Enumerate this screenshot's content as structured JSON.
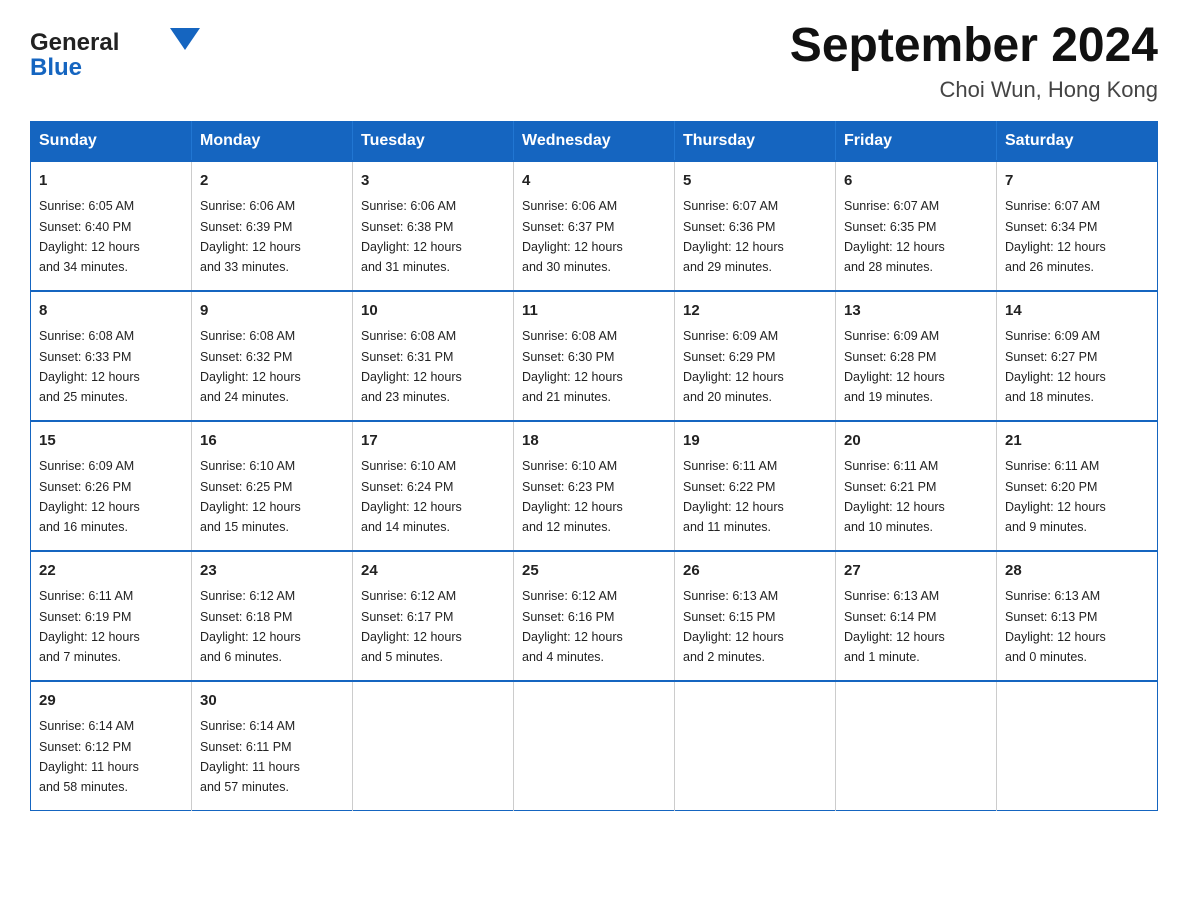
{
  "logo": {
    "text_general": "General",
    "text_blue": "Blue"
  },
  "title": "September 2024",
  "location": "Choi Wun, Hong Kong",
  "days_of_week": [
    "Sunday",
    "Monday",
    "Tuesday",
    "Wednesday",
    "Thursday",
    "Friday",
    "Saturday"
  ],
  "weeks": [
    [
      {
        "day": "1",
        "sunrise": "6:05 AM",
        "sunset": "6:40 PM",
        "daylight": "12 hours and 34 minutes."
      },
      {
        "day": "2",
        "sunrise": "6:06 AM",
        "sunset": "6:39 PM",
        "daylight": "12 hours and 33 minutes."
      },
      {
        "day": "3",
        "sunrise": "6:06 AM",
        "sunset": "6:38 PM",
        "daylight": "12 hours and 31 minutes."
      },
      {
        "day": "4",
        "sunrise": "6:06 AM",
        "sunset": "6:37 PM",
        "daylight": "12 hours and 30 minutes."
      },
      {
        "day": "5",
        "sunrise": "6:07 AM",
        "sunset": "6:36 PM",
        "daylight": "12 hours and 29 minutes."
      },
      {
        "day": "6",
        "sunrise": "6:07 AM",
        "sunset": "6:35 PM",
        "daylight": "12 hours and 28 minutes."
      },
      {
        "day": "7",
        "sunrise": "6:07 AM",
        "sunset": "6:34 PM",
        "daylight": "12 hours and 26 minutes."
      }
    ],
    [
      {
        "day": "8",
        "sunrise": "6:08 AM",
        "sunset": "6:33 PM",
        "daylight": "12 hours and 25 minutes."
      },
      {
        "day": "9",
        "sunrise": "6:08 AM",
        "sunset": "6:32 PM",
        "daylight": "12 hours and 24 minutes."
      },
      {
        "day": "10",
        "sunrise": "6:08 AM",
        "sunset": "6:31 PM",
        "daylight": "12 hours and 23 minutes."
      },
      {
        "day": "11",
        "sunrise": "6:08 AM",
        "sunset": "6:30 PM",
        "daylight": "12 hours and 21 minutes."
      },
      {
        "day": "12",
        "sunrise": "6:09 AM",
        "sunset": "6:29 PM",
        "daylight": "12 hours and 20 minutes."
      },
      {
        "day": "13",
        "sunrise": "6:09 AM",
        "sunset": "6:28 PM",
        "daylight": "12 hours and 19 minutes."
      },
      {
        "day": "14",
        "sunrise": "6:09 AM",
        "sunset": "6:27 PM",
        "daylight": "12 hours and 18 minutes."
      }
    ],
    [
      {
        "day": "15",
        "sunrise": "6:09 AM",
        "sunset": "6:26 PM",
        "daylight": "12 hours and 16 minutes."
      },
      {
        "day": "16",
        "sunrise": "6:10 AM",
        "sunset": "6:25 PM",
        "daylight": "12 hours and 15 minutes."
      },
      {
        "day": "17",
        "sunrise": "6:10 AM",
        "sunset": "6:24 PM",
        "daylight": "12 hours and 14 minutes."
      },
      {
        "day": "18",
        "sunrise": "6:10 AM",
        "sunset": "6:23 PM",
        "daylight": "12 hours and 12 minutes."
      },
      {
        "day": "19",
        "sunrise": "6:11 AM",
        "sunset": "6:22 PM",
        "daylight": "12 hours and 11 minutes."
      },
      {
        "day": "20",
        "sunrise": "6:11 AM",
        "sunset": "6:21 PM",
        "daylight": "12 hours and 10 minutes."
      },
      {
        "day": "21",
        "sunrise": "6:11 AM",
        "sunset": "6:20 PM",
        "daylight": "12 hours and 9 minutes."
      }
    ],
    [
      {
        "day": "22",
        "sunrise": "6:11 AM",
        "sunset": "6:19 PM",
        "daylight": "12 hours and 7 minutes."
      },
      {
        "day": "23",
        "sunrise": "6:12 AM",
        "sunset": "6:18 PM",
        "daylight": "12 hours and 6 minutes."
      },
      {
        "day": "24",
        "sunrise": "6:12 AM",
        "sunset": "6:17 PM",
        "daylight": "12 hours and 5 minutes."
      },
      {
        "day": "25",
        "sunrise": "6:12 AM",
        "sunset": "6:16 PM",
        "daylight": "12 hours and 4 minutes."
      },
      {
        "day": "26",
        "sunrise": "6:13 AM",
        "sunset": "6:15 PM",
        "daylight": "12 hours and 2 minutes."
      },
      {
        "day": "27",
        "sunrise": "6:13 AM",
        "sunset": "6:14 PM",
        "daylight": "12 hours and 1 minute."
      },
      {
        "day": "28",
        "sunrise": "6:13 AM",
        "sunset": "6:13 PM",
        "daylight": "12 hours and 0 minutes."
      }
    ],
    [
      {
        "day": "29",
        "sunrise": "6:14 AM",
        "sunset": "6:12 PM",
        "daylight": "11 hours and 58 minutes."
      },
      {
        "day": "30",
        "sunrise": "6:14 AM",
        "sunset": "6:11 PM",
        "daylight": "11 hours and 57 minutes."
      },
      null,
      null,
      null,
      null,
      null
    ]
  ],
  "labels": {
    "sunrise": "Sunrise:",
    "sunset": "Sunset:",
    "daylight": "Daylight:"
  }
}
